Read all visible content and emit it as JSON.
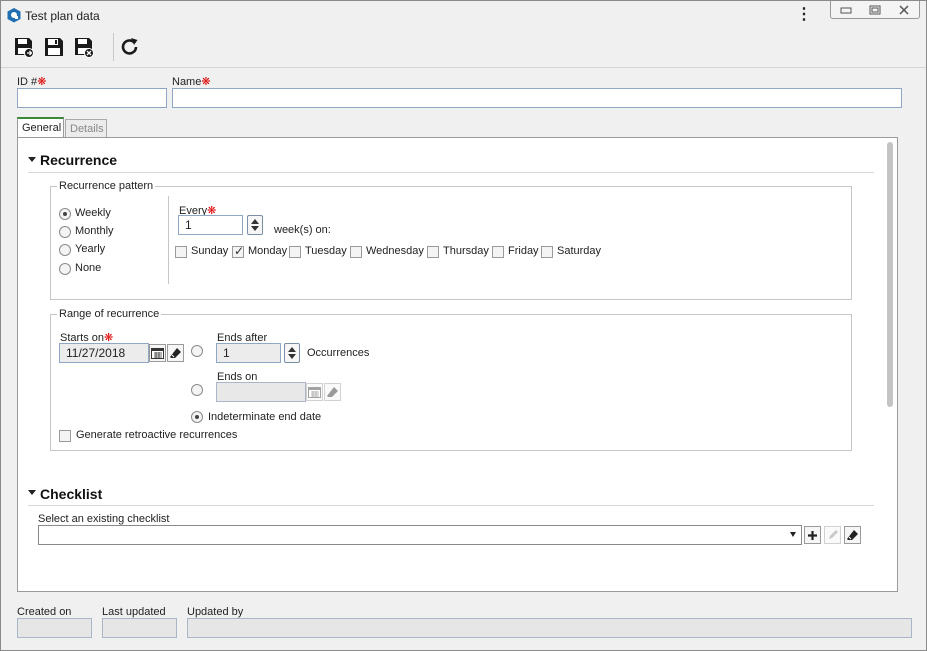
{
  "window": {
    "title": "Test plan data"
  },
  "toolbar": {
    "save_new_icon": "save-and-new-icon",
    "save_icon": "save-icon",
    "save_close_icon": "save-and-close-icon",
    "refresh_icon": "refresh-icon"
  },
  "header": {
    "id_label": "ID #",
    "id_value": "",
    "name_label": "Name",
    "name_value": ""
  },
  "tabs": [
    {
      "label": "General",
      "active": true
    },
    {
      "label": "Details",
      "active": false
    }
  ],
  "recurrence": {
    "title": "Recurrence",
    "pattern_legend": "Recurrence pattern",
    "pattern_options": [
      {
        "label": "Weekly",
        "selected": true
      },
      {
        "label": "Monthly",
        "selected": false
      },
      {
        "label": "Yearly",
        "selected": false
      },
      {
        "label": "None",
        "selected": false
      }
    ],
    "every_label": "Every",
    "every_value": "1",
    "weeks_on_label": "week(s) on:",
    "days": [
      {
        "label": "Sunday",
        "checked": false
      },
      {
        "label": "Monday",
        "checked": true
      },
      {
        "label": "Tuesday",
        "checked": false
      },
      {
        "label": "Wednesday",
        "checked": false
      },
      {
        "label": "Thursday",
        "checked": false
      },
      {
        "label": "Friday",
        "checked": false
      },
      {
        "label": "Saturday",
        "checked": false
      }
    ],
    "range_legend": "Range of recurrence",
    "starts_on_label": "Starts on",
    "starts_on_value": "11/27/2018",
    "ends_after_label": "Ends after",
    "ends_after_value": "1",
    "occurrences_label": "Occurrences",
    "ends_on_label": "Ends on",
    "ends_on_value": "",
    "indeterminate_label": "Indeterminate end date",
    "end_choice": "indeterminate",
    "retroactive_label": "Generate retroactive recurrences",
    "retroactive_checked": false
  },
  "checklist": {
    "title": "Checklist",
    "select_label": "Select an existing checklist",
    "select_value": ""
  },
  "footer": {
    "created_on_label": "Created on",
    "created_on_value": "",
    "last_updated_label": "Last updated",
    "last_updated_value": "",
    "updated_by_label": "Updated by",
    "updated_by_value": ""
  },
  "colors": {
    "accent_tab": "#3a8a3a",
    "required": "#dd0000",
    "input_border": "#8fa7c4"
  }
}
